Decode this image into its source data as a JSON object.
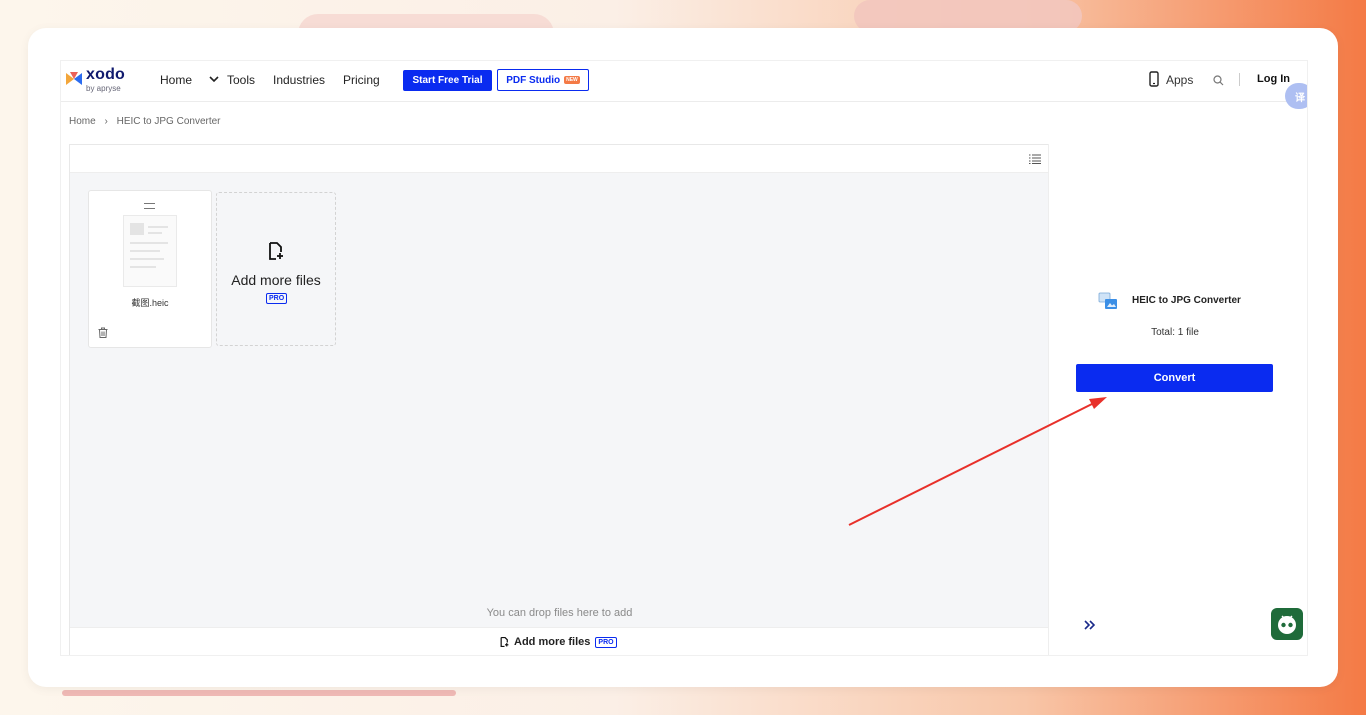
{
  "nav": {
    "logo_word": "xodo",
    "logo_sub": "by apryse",
    "home": "Home",
    "tools": "Tools",
    "industries": "Industries",
    "pricing": "Pricing",
    "start_trial": "Start Free Trial",
    "pdf_studio": "PDF Studio",
    "new_badge": "NEW",
    "apps": "Apps",
    "login": "Log In",
    "translate_glyph": "译"
  },
  "breadcrumb": {
    "home": "Home",
    "separator": "›",
    "current": "HEIC to JPG Converter"
  },
  "files": [
    {
      "name": "截图.heic"
    }
  ],
  "add_more": {
    "label": "Add more files",
    "pro": "PRO"
  },
  "drop_hint": "You can drop files here to add",
  "bottom_bar": {
    "label": "Add more files",
    "pro": "PRO"
  },
  "side_panel": {
    "title": "HEIC to JPG Converter",
    "total": "Total: 1 file",
    "convert": "Convert"
  },
  "colors": {
    "primary": "#0a2bf0",
    "accent": "#f47a45",
    "annotation_arrow": "#e8302a"
  },
  "icons": [
    "phone-icon",
    "search-icon",
    "list-view-icon",
    "drag-handle-icon",
    "trash-icon",
    "add-file-icon",
    "converter-icon",
    "expand-icon",
    "robot-assistant-icon"
  ]
}
